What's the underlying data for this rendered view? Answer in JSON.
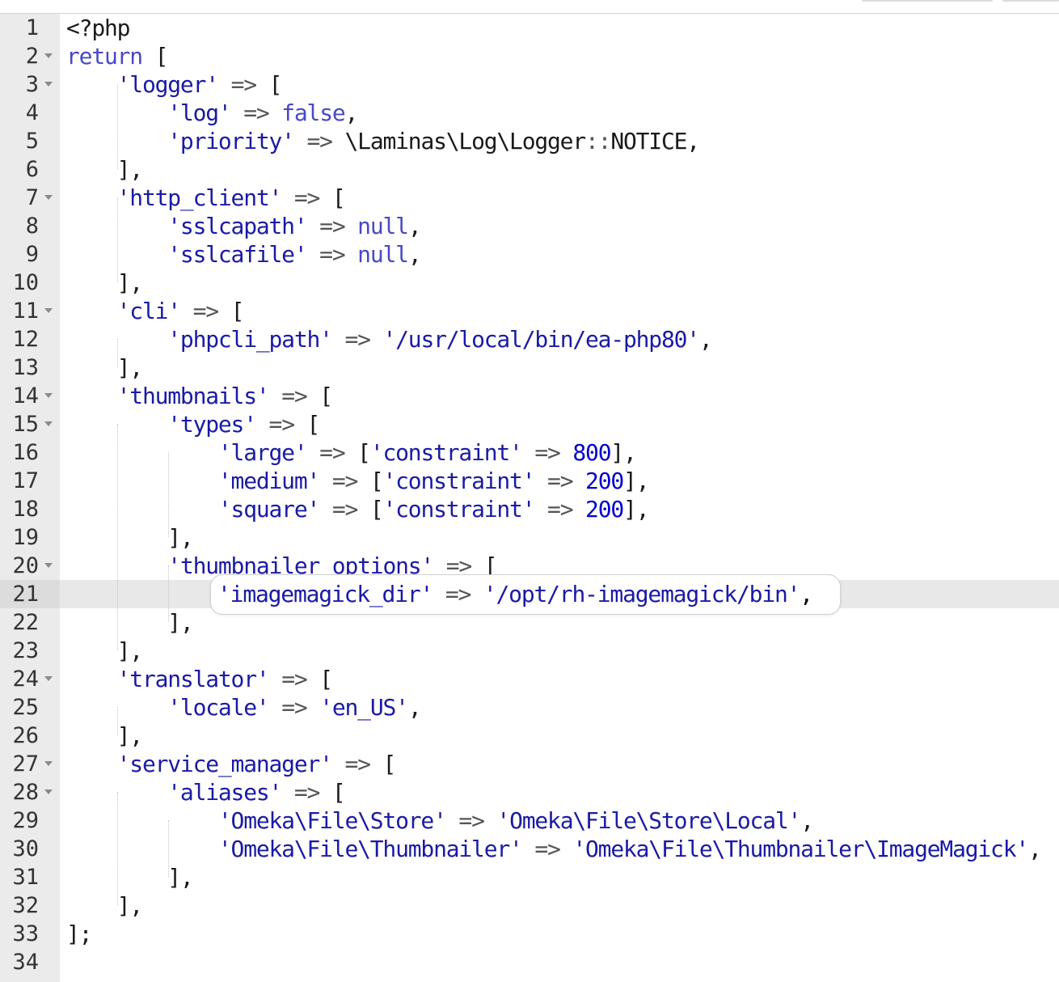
{
  "editor": {
    "language": "php",
    "active_line": 21,
    "lines": [
      {
        "n": "1",
        "fold": false,
        "tokens": [
          {
            "t": "<?php",
            "c": "plain"
          }
        ]
      },
      {
        "n": "2",
        "fold": true,
        "tokens": [
          {
            "t": "return",
            "c": "kw"
          },
          {
            "t": " [",
            "c": "plain"
          }
        ]
      },
      {
        "n": "3",
        "fold": true,
        "tokens": [
          {
            "t": "    ",
            "c": "plain"
          },
          {
            "t": "'logger'",
            "c": "str"
          },
          {
            "t": " ",
            "c": "plain"
          },
          {
            "t": "=>",
            "c": "op"
          },
          {
            "t": " [",
            "c": "plain"
          }
        ]
      },
      {
        "n": "4",
        "fold": false,
        "tokens": [
          {
            "t": "        ",
            "c": "plain"
          },
          {
            "t": "'log'",
            "c": "str"
          },
          {
            "t": " ",
            "c": "plain"
          },
          {
            "t": "=>",
            "c": "op"
          },
          {
            "t": " ",
            "c": "plain"
          },
          {
            "t": "false",
            "c": "kw"
          },
          {
            "t": ",",
            "c": "plain"
          }
        ]
      },
      {
        "n": "5",
        "fold": false,
        "tokens": [
          {
            "t": "        ",
            "c": "plain"
          },
          {
            "t": "'priority'",
            "c": "str"
          },
          {
            "t": " ",
            "c": "plain"
          },
          {
            "t": "=>",
            "c": "op"
          },
          {
            "t": " \\Laminas\\Log\\Logger",
            "c": "plain"
          },
          {
            "t": "::",
            "c": "op"
          },
          {
            "t": "NOTICE,",
            "c": "plain"
          }
        ]
      },
      {
        "n": "6",
        "fold": false,
        "tokens": [
          {
            "t": "    ],",
            "c": "plain"
          }
        ]
      },
      {
        "n": "7",
        "fold": true,
        "tokens": [
          {
            "t": "    ",
            "c": "plain"
          },
          {
            "t": "'http_client'",
            "c": "str"
          },
          {
            "t": " ",
            "c": "plain"
          },
          {
            "t": "=>",
            "c": "op"
          },
          {
            "t": " [",
            "c": "plain"
          }
        ]
      },
      {
        "n": "8",
        "fold": false,
        "tokens": [
          {
            "t": "        ",
            "c": "plain"
          },
          {
            "t": "'sslcapath'",
            "c": "str"
          },
          {
            "t": " ",
            "c": "plain"
          },
          {
            "t": "=>",
            "c": "op"
          },
          {
            "t": " ",
            "c": "plain"
          },
          {
            "t": "null",
            "c": "kw"
          },
          {
            "t": ",",
            "c": "plain"
          }
        ]
      },
      {
        "n": "9",
        "fold": false,
        "tokens": [
          {
            "t": "        ",
            "c": "plain"
          },
          {
            "t": "'sslcafile'",
            "c": "str"
          },
          {
            "t": " ",
            "c": "plain"
          },
          {
            "t": "=>",
            "c": "op"
          },
          {
            "t": " ",
            "c": "plain"
          },
          {
            "t": "null",
            "c": "kw"
          },
          {
            "t": ",",
            "c": "plain"
          }
        ]
      },
      {
        "n": "10",
        "fold": false,
        "tokens": [
          {
            "t": "    ],",
            "c": "plain"
          }
        ]
      },
      {
        "n": "11",
        "fold": true,
        "tokens": [
          {
            "t": "    ",
            "c": "plain"
          },
          {
            "t": "'cli'",
            "c": "str"
          },
          {
            "t": " ",
            "c": "plain"
          },
          {
            "t": "=>",
            "c": "op"
          },
          {
            "t": " [",
            "c": "plain"
          }
        ]
      },
      {
        "n": "12",
        "fold": false,
        "tokens": [
          {
            "t": "        ",
            "c": "plain"
          },
          {
            "t": "'phpcli_path'",
            "c": "str"
          },
          {
            "t": " ",
            "c": "plain"
          },
          {
            "t": "=>",
            "c": "op"
          },
          {
            "t": " ",
            "c": "plain"
          },
          {
            "t": "'/usr/local/bin/ea-php80'",
            "c": "str"
          },
          {
            "t": ",",
            "c": "plain"
          }
        ]
      },
      {
        "n": "13",
        "fold": false,
        "tokens": [
          {
            "t": "    ],",
            "c": "plain"
          }
        ]
      },
      {
        "n": "14",
        "fold": true,
        "tokens": [
          {
            "t": "    ",
            "c": "plain"
          },
          {
            "t": "'thumbnails'",
            "c": "str"
          },
          {
            "t": " ",
            "c": "plain"
          },
          {
            "t": "=>",
            "c": "op"
          },
          {
            "t": " [",
            "c": "plain"
          }
        ]
      },
      {
        "n": "15",
        "fold": true,
        "tokens": [
          {
            "t": "        ",
            "c": "plain"
          },
          {
            "t": "'types'",
            "c": "str"
          },
          {
            "t": " ",
            "c": "plain"
          },
          {
            "t": "=>",
            "c": "op"
          },
          {
            "t": " [",
            "c": "plain"
          }
        ]
      },
      {
        "n": "16",
        "fold": false,
        "tokens": [
          {
            "t": "            ",
            "c": "plain"
          },
          {
            "t": "'large'",
            "c": "str"
          },
          {
            "t": " ",
            "c": "plain"
          },
          {
            "t": "=>",
            "c": "op"
          },
          {
            "t": " [",
            "c": "plain"
          },
          {
            "t": "'constraint'",
            "c": "str"
          },
          {
            "t": " ",
            "c": "plain"
          },
          {
            "t": "=>",
            "c": "op"
          },
          {
            "t": " ",
            "c": "plain"
          },
          {
            "t": "800",
            "c": "num"
          },
          {
            "t": "],",
            "c": "plain"
          }
        ]
      },
      {
        "n": "17",
        "fold": false,
        "tokens": [
          {
            "t": "            ",
            "c": "plain"
          },
          {
            "t": "'medium'",
            "c": "str"
          },
          {
            "t": " ",
            "c": "plain"
          },
          {
            "t": "=>",
            "c": "op"
          },
          {
            "t": " [",
            "c": "plain"
          },
          {
            "t": "'constraint'",
            "c": "str"
          },
          {
            "t": " ",
            "c": "plain"
          },
          {
            "t": "=>",
            "c": "op"
          },
          {
            "t": " ",
            "c": "plain"
          },
          {
            "t": "200",
            "c": "num"
          },
          {
            "t": "],",
            "c": "plain"
          }
        ]
      },
      {
        "n": "18",
        "fold": false,
        "tokens": [
          {
            "t": "            ",
            "c": "plain"
          },
          {
            "t": "'square'",
            "c": "str"
          },
          {
            "t": " ",
            "c": "plain"
          },
          {
            "t": "=>",
            "c": "op"
          },
          {
            "t": " [",
            "c": "plain"
          },
          {
            "t": "'constraint'",
            "c": "str"
          },
          {
            "t": " ",
            "c": "plain"
          },
          {
            "t": "=>",
            "c": "op"
          },
          {
            "t": " ",
            "c": "plain"
          },
          {
            "t": "200",
            "c": "num"
          },
          {
            "t": "],",
            "c": "plain"
          }
        ]
      },
      {
        "n": "19",
        "fold": false,
        "tokens": [
          {
            "t": "        ],",
            "c": "plain"
          }
        ]
      },
      {
        "n": "20",
        "fold": true,
        "tokens": [
          {
            "t": "        ",
            "c": "plain"
          },
          {
            "t": "'thumbnailer_options'",
            "c": "str"
          },
          {
            "t": " ",
            "c": "plain"
          },
          {
            "t": "=>",
            "c": "op"
          },
          {
            "t": " [",
            "c": "plain"
          }
        ]
      },
      {
        "n": "21",
        "fold": false,
        "tokens": []
      },
      {
        "n": "22",
        "fold": false,
        "tokens": [
          {
            "t": "        ],",
            "c": "plain"
          }
        ]
      },
      {
        "n": "23",
        "fold": false,
        "tokens": [
          {
            "t": "    ],",
            "c": "plain"
          }
        ]
      },
      {
        "n": "24",
        "fold": true,
        "tokens": [
          {
            "t": "    ",
            "c": "plain"
          },
          {
            "t": "'translator'",
            "c": "str"
          },
          {
            "t": " ",
            "c": "plain"
          },
          {
            "t": "=>",
            "c": "op"
          },
          {
            "t": " [",
            "c": "plain"
          }
        ]
      },
      {
        "n": "25",
        "fold": false,
        "tokens": [
          {
            "t": "        ",
            "c": "plain"
          },
          {
            "t": "'locale'",
            "c": "str"
          },
          {
            "t": " ",
            "c": "plain"
          },
          {
            "t": "=>",
            "c": "op"
          },
          {
            "t": " ",
            "c": "plain"
          },
          {
            "t": "'en_US'",
            "c": "str"
          },
          {
            "t": ",",
            "c": "plain"
          }
        ]
      },
      {
        "n": "26",
        "fold": false,
        "tokens": [
          {
            "t": "    ],",
            "c": "plain"
          }
        ]
      },
      {
        "n": "27",
        "fold": true,
        "tokens": [
          {
            "t": "    ",
            "c": "plain"
          },
          {
            "t": "'service_manager'",
            "c": "str"
          },
          {
            "t": " ",
            "c": "plain"
          },
          {
            "t": "=>",
            "c": "op"
          },
          {
            "t": " [",
            "c": "plain"
          }
        ]
      },
      {
        "n": "28",
        "fold": true,
        "tokens": [
          {
            "t": "        ",
            "c": "plain"
          },
          {
            "t": "'aliases'",
            "c": "str"
          },
          {
            "t": " ",
            "c": "plain"
          },
          {
            "t": "=>",
            "c": "op"
          },
          {
            "t": " [",
            "c": "plain"
          }
        ]
      },
      {
        "n": "29",
        "fold": false,
        "tokens": [
          {
            "t": "            ",
            "c": "plain"
          },
          {
            "t": "'Omeka\\File\\Store'",
            "c": "str"
          },
          {
            "t": " ",
            "c": "plain"
          },
          {
            "t": "=>",
            "c": "op"
          },
          {
            "t": " ",
            "c": "plain"
          },
          {
            "t": "'Omeka\\File\\Store\\Local'",
            "c": "str"
          },
          {
            "t": ",",
            "c": "plain"
          }
        ]
      },
      {
        "n": "30",
        "fold": false,
        "tokens": [
          {
            "t": "            ",
            "c": "plain"
          },
          {
            "t": "'Omeka\\File\\Thumbnailer'",
            "c": "str"
          },
          {
            "t": " ",
            "c": "plain"
          },
          {
            "t": "=>",
            "c": "op"
          },
          {
            "t": " ",
            "c": "plain"
          },
          {
            "t": "'Omeka\\File\\Thumbnailer\\ImageMagick'",
            "c": "str"
          },
          {
            "t": ",",
            "c": "plain"
          }
        ]
      },
      {
        "n": "31",
        "fold": false,
        "tokens": [
          {
            "t": "        ],",
            "c": "plain"
          }
        ]
      },
      {
        "n": "32",
        "fold": false,
        "tokens": [
          {
            "t": "    ],",
            "c": "plain"
          }
        ]
      },
      {
        "n": "33",
        "fold": false,
        "tokens": [
          {
            "t": "];",
            "c": "plain"
          }
        ]
      },
      {
        "n": "34",
        "fold": false,
        "tokens": []
      }
    ],
    "highlight": {
      "line": "21",
      "key": "'imagemagick_dir'",
      "arrow": "=>",
      "value": "'/opt/rh-imagemagick/bin'",
      "trail": ","
    }
  },
  "colors": {
    "string": "#1a1aa6",
    "keyword": "#4848c8",
    "number": "#0000cd",
    "plain": "#1a1a1a",
    "gutter_bg": "#ebebeb",
    "active_line_bg": "#e8e8e8"
  }
}
